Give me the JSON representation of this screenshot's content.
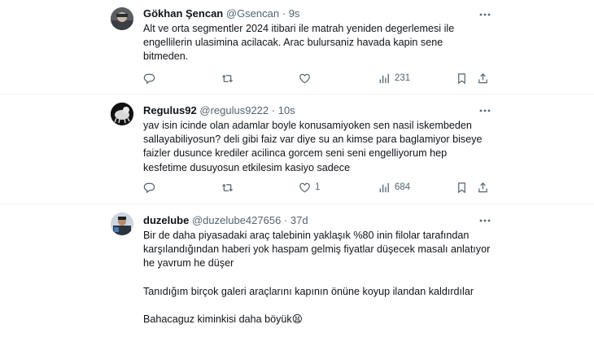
{
  "tweets": [
    {
      "name": "Gökhan Şencan",
      "handle": "@Gsencan",
      "separator": "·",
      "time": "9s",
      "text": "Alt ve orta segmentler 2024 itibari ile matrah yeniden degerlemesi ile engellilerin ulasimina acilacak. Arac bulursaniz havada kapin sene bitmeden.",
      "replies": "",
      "retweets": "",
      "likes": "",
      "views": "231"
    },
    {
      "name": "Regulus92",
      "handle": "@regulus9222",
      "separator": "·",
      "time": "10s",
      "text": "yav isin icinde olan adamlar boyle konusamiyoken sen nasil iskembeden sallayabiliyosun? deli gibi faiz var diye su an kimse para baglamiyor biseye faizler dusunce krediler acilinca gorcem seni seni engelliyorum hep kesfetime dusuyosun etkilesim kasiyo sadece",
      "replies": "",
      "retweets": "",
      "likes": "1",
      "views": "684"
    },
    {
      "name": "duzelube",
      "handle": "@duzelube427656",
      "separator": "·",
      "time": "37d",
      "text": "Bir de daha piyasadaki araç talebinin yaklaşık %80 inin filolar tarafından karşılandığından haberi yok haspam gelmiş fiyatlar düşecek masalı anlatıyor\nhe yavrum he düşer\n\nTanıdığım birçok galeri araçlarını kapının önüne koyup ilandan kaldırdılar\n\nBahacaguz kiminkisi daha böyük😫"
    }
  ]
}
